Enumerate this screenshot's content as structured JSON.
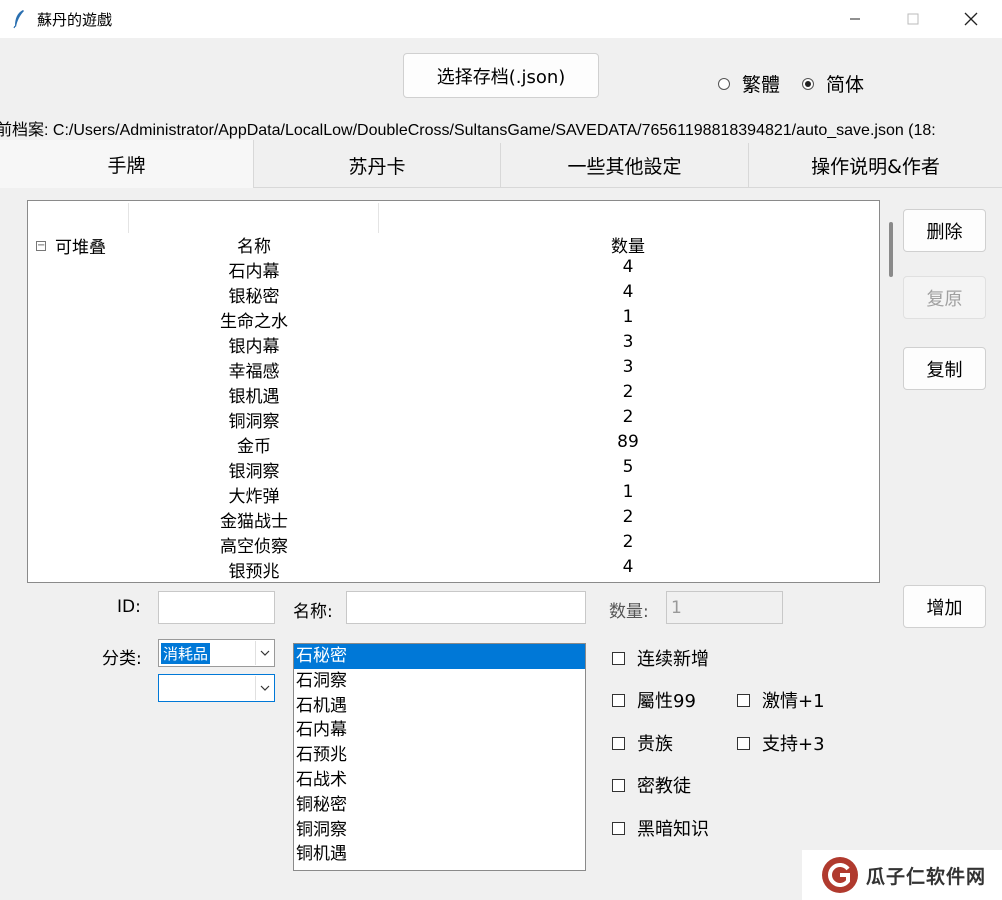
{
  "window": {
    "title": "蘇丹的遊戲"
  },
  "header": {
    "select_button": "选择存档(.json)",
    "lang_options": [
      {
        "label": "繁體",
        "selected": false
      },
      {
        "label": "简体",
        "selected": true
      }
    ],
    "path_text": "前档案: C:/Users/Administrator/AppData/LocalLow/DoubleCross/SultansGame/SAVEDATA/76561198818394821/auto_save.json (18:"
  },
  "tabs": [
    {
      "label": "手牌",
      "active": true
    },
    {
      "label": "苏丹卡",
      "active": false
    },
    {
      "label": "一些其他設定",
      "active": false
    },
    {
      "label": "操作说明&作者",
      "active": false
    }
  ],
  "tree": {
    "group_label": "可堆叠",
    "header": {
      "name": "名称",
      "qty": "数量"
    },
    "rows": [
      {
        "name": "石内幕",
        "qty": "4"
      },
      {
        "name": "银秘密",
        "qty": "4"
      },
      {
        "name": "生命之水",
        "qty": "1"
      },
      {
        "name": "银内幕",
        "qty": "3"
      },
      {
        "name": "幸福感",
        "qty": "3"
      },
      {
        "name": "银机遇",
        "qty": "2"
      },
      {
        "name": "铜洞察",
        "qty": "2"
      },
      {
        "name": "金币",
        "qty": "89"
      },
      {
        "name": "银洞察",
        "qty": "5"
      },
      {
        "name": "大炸弹",
        "qty": "1"
      },
      {
        "name": "金猫战士",
        "qty": "2"
      },
      {
        "name": "高空侦察",
        "qty": "2"
      },
      {
        "name": "银预兆",
        "qty": "4"
      }
    ]
  },
  "side_buttons": {
    "delete": "删除",
    "restore": "复原",
    "copy": "复制",
    "add": "增加"
  },
  "form": {
    "id_label": "ID:",
    "id_value": "",
    "name_label": "名称:",
    "name_value": "",
    "qty_label": "数量:",
    "qty_value": "1",
    "category_label": "分类:",
    "category_value": "消耗品",
    "subcategory_value": ""
  },
  "listbox_items": [
    {
      "label": "石秘密",
      "selected": true
    },
    {
      "label": "石洞察",
      "selected": false
    },
    {
      "label": "石机遇",
      "selected": false
    },
    {
      "label": "石内幕",
      "selected": false
    },
    {
      "label": "石预兆",
      "selected": false
    },
    {
      "label": "石战术",
      "selected": false
    },
    {
      "label": "铜秘密",
      "selected": false
    },
    {
      "label": "铜洞察",
      "selected": false
    },
    {
      "label": "铜机遇",
      "selected": false
    }
  ],
  "checkboxes": {
    "continuous_add": "连续新增",
    "attr99": "屬性99",
    "passion": "激情+1",
    "noble": "贵族",
    "support": "支持+3",
    "cultist": "密教徒",
    "dark_knowledge": "黑暗知识"
  },
  "watermark": {
    "text": "瓜子仁软件网",
    "color": "#c0392b"
  }
}
